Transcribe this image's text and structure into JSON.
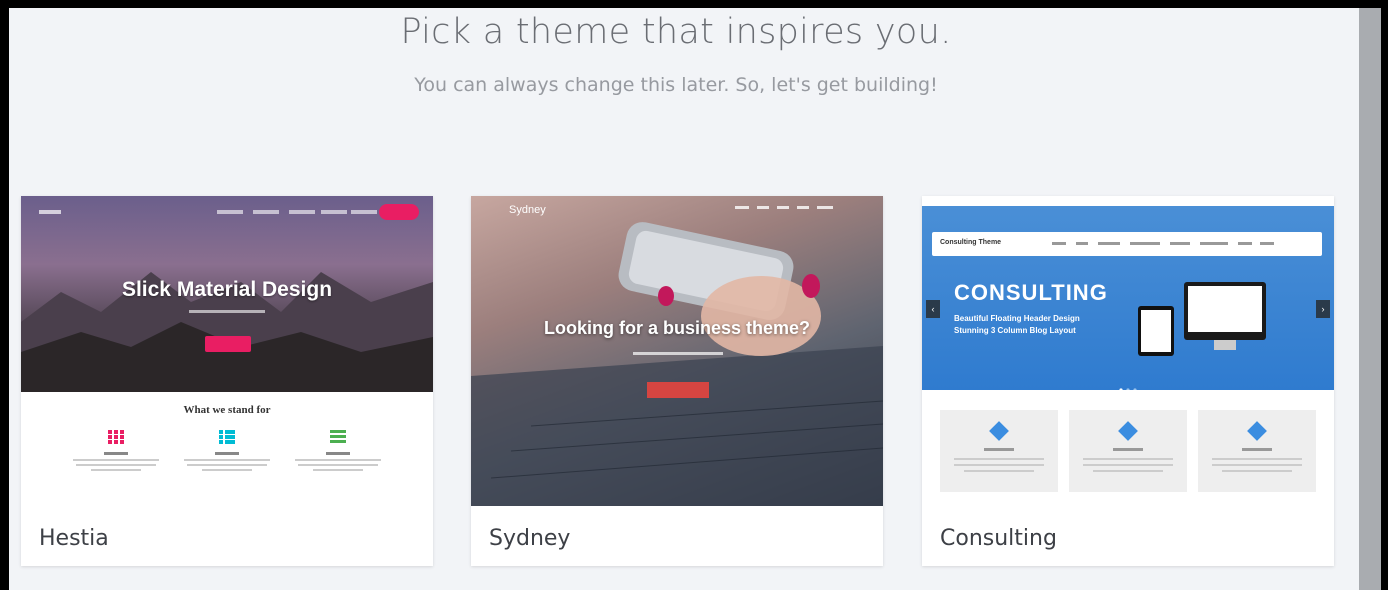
{
  "header": {
    "title": "Pick a theme that inspires you.",
    "subtitle": "You can always change this later. So, let's get building!"
  },
  "themes": [
    {
      "name": "Hestia",
      "preview": {
        "hero_title": "Slick Material Design",
        "section_title": "What we stand for",
        "accent": "#e91e63",
        "feature_icon_colors": [
          "#e91e63",
          "#00bcd4",
          "#4caf50"
        ]
      }
    },
    {
      "name": "Sydney",
      "preview": {
        "brand": "Sydney",
        "hero_title": "Looking for a business theme?",
        "accent": "#d64541"
      }
    },
    {
      "name": "Consulting",
      "preview": {
        "brand": "Consulting Theme",
        "hero_title": "CONSULTING",
        "hero_line1": "Beautiful Floating Header Design",
        "hero_line2": "Stunning 3 Column Blog Layout",
        "accent": "#3b8de0"
      }
    }
  ]
}
